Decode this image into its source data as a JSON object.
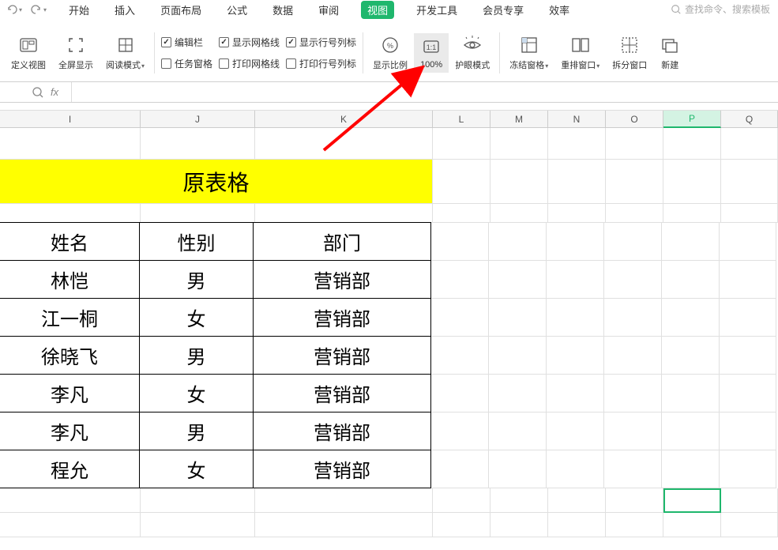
{
  "qat": {
    "undo": "↶",
    "redo": "↷"
  },
  "menu": {
    "tabs": [
      "开始",
      "插入",
      "页面布局",
      "公式",
      "数据",
      "审阅",
      "视图",
      "开发工具",
      "会员专享",
      "效率"
    ],
    "activeIndex": 6
  },
  "search": {
    "placeholder": "查找命令、搜索模板"
  },
  "ribbon": {
    "customView": "定义视图",
    "fullscreen": "全屏显示",
    "readMode": "阅读模式",
    "checkboxes": {
      "editBar": "编辑栏",
      "taskPane": "任务窗格",
      "showGrid": "显示网格线",
      "printGrid": "打印网格线",
      "showRowCol": "显示行号列标",
      "printRowCol": "打印行号列标"
    },
    "zoom": "显示比例",
    "hundred": "100%",
    "eyeProtect": "护眼模式",
    "freezePanes": "冻结窗格",
    "arrangeWin": "重排窗口",
    "splitWin": "拆分窗口",
    "newWin": "新建"
  },
  "formula": {
    "fx": "fx"
  },
  "columns": [
    "I",
    "J",
    "K",
    "L",
    "M",
    "N",
    "O",
    "P",
    "Q"
  ],
  "selectedColumn": "P",
  "table": {
    "title": "原表格",
    "headers": [
      "姓名",
      "性别",
      "部门"
    ],
    "rows": [
      [
        "林恺",
        "男",
        "营销部"
      ],
      [
        "江一桐",
        "女",
        "营销部"
      ],
      [
        "徐晓飞",
        "男",
        "营销部"
      ],
      [
        "李凡",
        "女",
        "营销部"
      ],
      [
        "李凡",
        "男",
        "营销部"
      ],
      [
        "程允",
        "女",
        "营销部"
      ]
    ]
  },
  "colWidths": {
    "left": 0,
    "I": 178,
    "J": 145,
    "K": 225,
    "rest": 73
  }
}
